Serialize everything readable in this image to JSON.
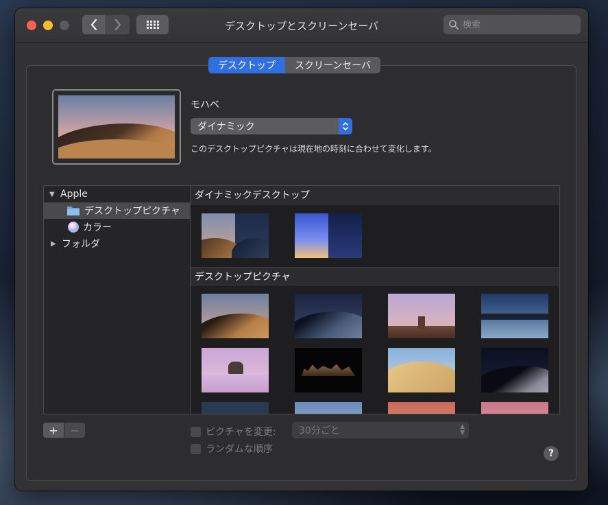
{
  "window": {
    "title": "デスクトップとスクリーンセーバ",
    "search_placeholder": "検索"
  },
  "tabs": [
    {
      "label": "デスクトップ",
      "active": true
    },
    {
      "label": "スクリーンセーバ",
      "active": false
    }
  ],
  "current": {
    "name": "モハベ",
    "mode": "ダイナミック",
    "description": "このデスクトップピクチャは現在地の時刻に合わせて変化します。"
  },
  "sidebar": {
    "group": "Apple",
    "items": [
      {
        "label": "デスクトップピクチャ",
        "icon": "folder-icon",
        "selected": true
      },
      {
        "label": "カラー",
        "icon": "color-wheel-icon",
        "selected": false
      }
    ],
    "folders": "フォルダ"
  },
  "gallery": {
    "sections": [
      {
        "title": "ダイナミックデスクトップ"
      },
      {
        "title": "デスクトップピクチャ"
      }
    ]
  },
  "bottom": {
    "add": "+",
    "remove": "−",
    "change_picture": "ピクチャを変更:",
    "interval": "30分ごと",
    "random_order": "ランダムな順序",
    "help": "?"
  },
  "colors": {
    "accent": "#2f6fe0",
    "window_bg": "#323234"
  }
}
